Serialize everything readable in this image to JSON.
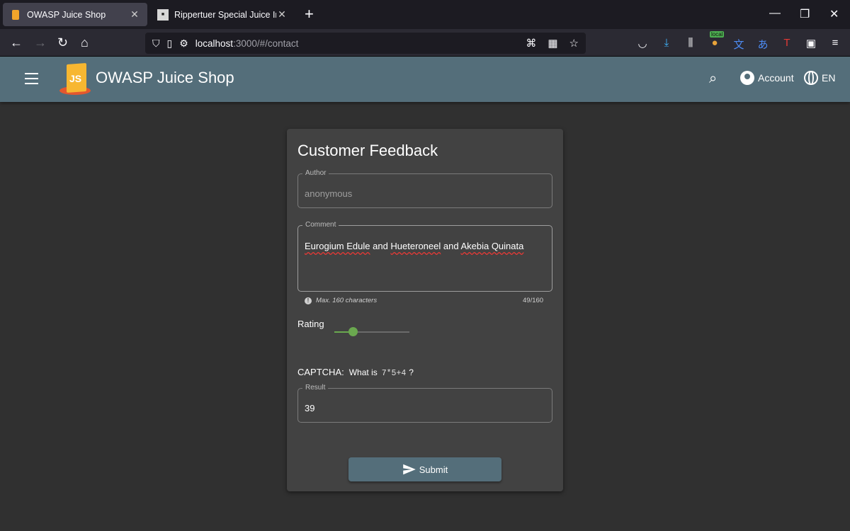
{
  "browser": {
    "tabs": [
      {
        "title": "OWASP Juice Shop",
        "active": true
      },
      {
        "title": "Rippertuer Special Juice Ingredi",
        "active": false
      }
    ],
    "url_host": "localhost",
    "url_path": ":3000/#/contact",
    "local_badge": "local"
  },
  "app": {
    "title": "OWASP Juice Shop",
    "logo_text": "JS",
    "account_label": "Account",
    "language": "EN"
  },
  "feedback": {
    "title": "Customer Feedback",
    "author_label": "Author",
    "author_value": "anonymous",
    "comment_label": "Comment",
    "comment_words": [
      "Eurogium Edule",
      " and ",
      "Hueteroneel",
      " and ",
      "Akebia Quinata"
    ],
    "hint": "Max. 160 characters",
    "counter": "49/160",
    "rating_label": "Rating",
    "rating_value": 1,
    "rating_max": 5,
    "captcha_label": "CAPTCHA:",
    "captcha_question": "What is",
    "captcha_expression": "7*5+4",
    "captcha_qmark": "?",
    "result_label": "Result",
    "result_value": "39",
    "submit_label": "Submit"
  },
  "colors": {
    "toolbar": "#546e7a",
    "card": "#424242",
    "background": "#303030",
    "slider_accent": "#6aa84f"
  }
}
